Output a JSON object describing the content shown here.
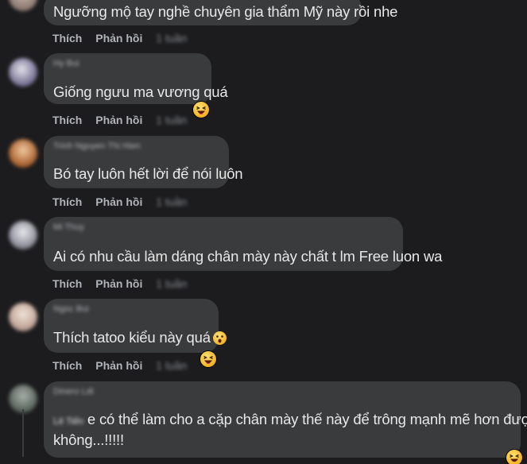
{
  "labels": {
    "like": "Thích",
    "reply": "Phản hồi"
  },
  "comments": [
    {
      "name": "",
      "text": "Ngưỡng mộ tay nghề chuyên gia thẩm Mỹ này rồi nhe",
      "time": "1 tuần"
    },
    {
      "name": "Hy Bui",
      "text": "Giống ngưu ma vương quá",
      "time": "1 tuần",
      "reaction_icon": "laughing-emoji-icon"
    },
    {
      "name": "Trinh Nguyen Thi Hien",
      "text": "Bó tay luôn hết lời để nói luôn",
      "time": "1 tuần"
    },
    {
      "name": "Mi Thuy",
      "text": "Ai có nhu cầu làm dáng chân mày này chất t lm Free luon wa",
      "time": "1 tuần"
    },
    {
      "name": "Ngoc Bui",
      "text": "Thích tatoo kiểu này quá",
      "time": "1 tuần",
      "inline_icon": "surprised-emoji-icon",
      "reaction_icon": "laughing-emoji-icon"
    },
    {
      "name": "Dinero Ldt",
      "mention": "Lê Tiến",
      "text_line1": "e có thể làm cho a cặp chân mày thế này để trông mạnh mẽ hơn được",
      "text_line2": "không...!!!!!",
      "reaction_icon": "laughing-emoji-icon"
    }
  ],
  "colors": {
    "background": "#1c1c1e",
    "bubble": "#3a3b3c",
    "text": "#e8e8e8",
    "secondary": "#b0b3b8"
  }
}
